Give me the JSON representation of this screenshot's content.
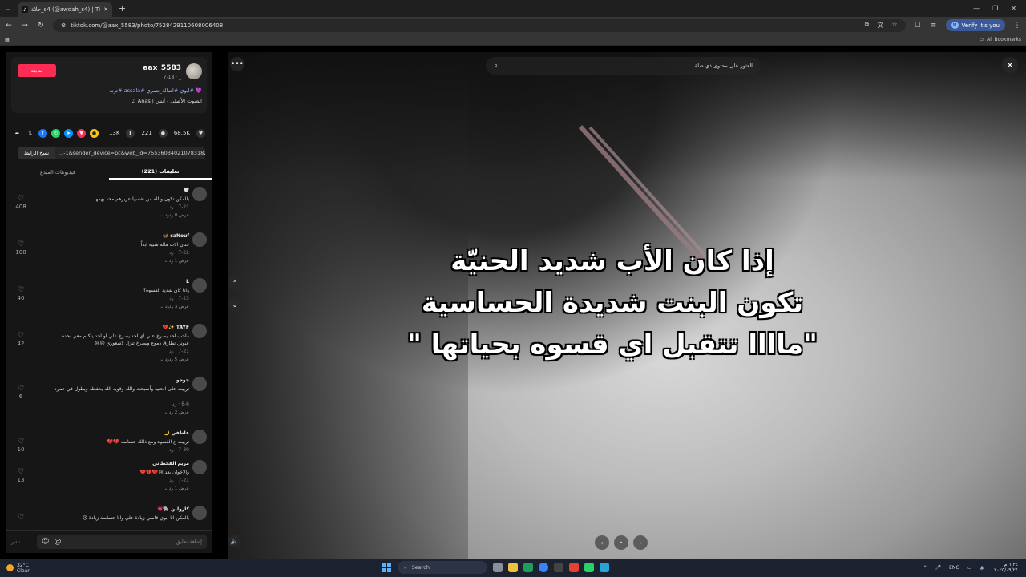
{
  "browser": {
    "tab_title": "حلاة_s4 (@awdah_s4) | TikTok",
    "new_tab": "+",
    "url": "tiktok.com/@aax_5583/photo/7528429110608006408",
    "verify_label": "Verify it's you",
    "verify_avatar": "M",
    "all_bookmarks": "All Bookmarks"
  },
  "author": {
    "name": "aax_5583",
    "date": "7-18 · _",
    "follow_label": "متابعة",
    "tags": "💜 #ابوي #اصالة_نصري #assala #ترند",
    "music": "الصوت الأصلي - أنس | Anas ♫"
  },
  "stats": {
    "likes": "68.5K",
    "comments": "221",
    "saves": "13K"
  },
  "link": {
    "copy_label": "نسخ الرابط",
    "url_text": "...-1&sender_device=pc&web_id=7553603402107831829"
  },
  "tabs": {
    "comments": "تعليقات (221)",
    "creator_videos": "فيديوهات المبدع"
  },
  "comments": [
    {
      "user": "🤍",
      "text": "بالمكن تكون والله من نفسها عزيزهم محد يهمها",
      "date": "7-21 · رد",
      "replies": "عرض 8 ردود ⌄",
      "likes": "408"
    },
    {
      "user": "saNouf 🦋",
      "text": "حنان الاب ماله شبيه ابداً",
      "date": "7-22 · رد",
      "replies": "عرض 1 رد ⌄",
      "likes": "108"
    },
    {
      "user": "L",
      "text": "وانا كان شديد القسوه؟",
      "date": "7-23 · رد",
      "replies": "عرض 3 ردود ⌄",
      "likes": "40"
    },
    {
      "user": "TAYF ✨💔",
      "text": "ماحب احد يصرخ علي اي احد يصرخ علي او احد يتكلم معي بحده عيوني تطارق دموع ويصرخ تنزل لاشعوري 😢😢",
      "date": "7-21 · رد",
      "replies": "عرض 5 ردود ⌄",
      "likes": "42"
    },
    {
      "user": "جوجو",
      "text": "تربيت على الحنيه وأسبحت والله وقويه الله يحفظه ويطول في عمره",
      "date": "8-6 · رد",
      "replies": "عرض 2 رد ⌄",
      "likes": "6"
    },
    {
      "user": "عاطفي 🌙",
      "text": "تربيت ع القسوه ومع ذالك حساسه 💔💔",
      "date": "7-30 · رد",
      "replies": "",
      "likes": "10"
    },
    {
      "user": "مريم القحطاني",
      "text": "والاخوان بعد 😢💔💔💔",
      "date": "7-21 · رد",
      "replies": "عرض 1 رد ⌄",
      "likes": "13"
    },
    {
      "user": "كارولين 🐘💗",
      "text": "بالمكن انا ابوي قاسي زيادة علي وانا حساسة زيادة 😢",
      "date": "",
      "replies": "",
      "likes": ""
    }
  ],
  "comment_input": {
    "placeholder": "إضافة تعليق...",
    "post_label": "نشر",
    "mention": "@",
    "emoji": "☺"
  },
  "viewer": {
    "search_placeholder": "العثور على محتوى ذي صلة",
    "overlay_lines": [
      "إذا كان الأب شديد الحنيّة",
      "تكون البنت شديدة الحساسية",
      "\"ماااا تتقبل اي قسوه بحياتها \""
    ]
  },
  "taskbar": {
    "temp": "32°C",
    "condition": "Clear",
    "search_label": "Search",
    "lang": "ENG",
    "time": "٦:٣٤ م",
    "date": "٢٠٢٥/٠٩/٢٤"
  }
}
